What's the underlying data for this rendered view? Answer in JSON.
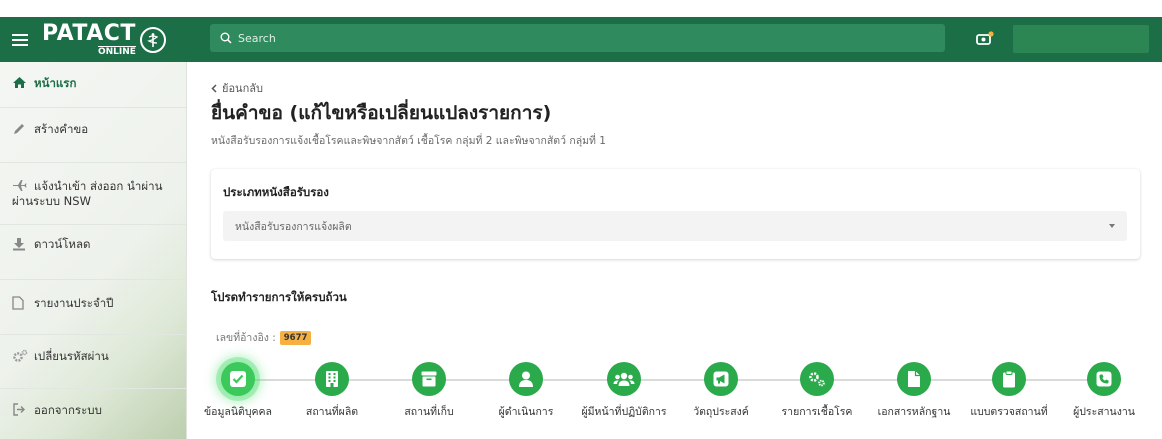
{
  "topbar": {
    "brand_main": "PATACT",
    "brand_sub": "ONLINE",
    "search_placeholder": "Search"
  },
  "sidebar": {
    "items": [
      {
        "label": "หน้าแรก",
        "icon": "home-icon",
        "active": true
      },
      {
        "label": "สร้างคำขอ",
        "icon": "pencil-icon"
      },
      {
        "label": "แจ้งนำเข้า ส่งออก นำผ่าน ผ่านระบบ NSW",
        "icon": "airplane-icon"
      },
      {
        "label": "ดาวน์โหลด",
        "icon": "download-icon"
      },
      {
        "label": "รายงานประจำปี",
        "icon": "file-icon"
      },
      {
        "label": "เปลี่ยนรหัสผ่าน",
        "icon": "gears-icon"
      },
      {
        "label": "ออกจากระบบ",
        "icon": "sign-out-icon"
      }
    ]
  },
  "main": {
    "back_label": "ย้อนกลับ",
    "title": "ยื่นคำขอ (แก้ไขหรือเปลี่ยนแปลงรายการ)",
    "subtitle": "หนังสือรับรองการแจ้งเชื้อโรคและพิษจากสัตว์ เชื้อโรค กลุ่มที่ 2 และพิษจากสัตว์ กลุ่มที่ 1",
    "card": {
      "title": "ประเภทหนังสือรับรอง",
      "select_value": "หนังสือรับรองการแจ้งผลิต"
    },
    "section_title": "โปรดทำรายการให้ครบถ้วน",
    "ref_label": "เลขที่อ้างอิง :",
    "ref_value": "9677"
  },
  "steps": [
    {
      "label": "ข้อมูลนิติบุคคล",
      "icon": "check-square-icon",
      "active": true
    },
    {
      "label": "สถานที่ผลิต",
      "icon": "building-icon"
    },
    {
      "label": "สถานที่เก็บ",
      "icon": "archive-box-icon"
    },
    {
      "label": "ผู้ดำเนินการ",
      "icon": "user-icon"
    },
    {
      "label": "ผู้มีหน้าที่ปฏิบัติการ",
      "icon": "users-icon"
    },
    {
      "label": "วัตถุประสงค์",
      "icon": "megaphone-icon"
    },
    {
      "label": "รายการเชื้อโรค",
      "icon": "cogs-icon"
    },
    {
      "label": "เอกสารหลักฐาน",
      "icon": "document-icon"
    },
    {
      "label": "แบบตรวจสถานที่",
      "icon": "clipboard-icon"
    },
    {
      "label": "ผู้ประสานงาน",
      "icon": "phone-square-icon"
    }
  ],
  "colors": {
    "topbar": "#1b6e46",
    "search": "#2f8a5d",
    "step": "#2aaa4a",
    "active_text": "#1b6e46",
    "badge": "#f5b041"
  }
}
